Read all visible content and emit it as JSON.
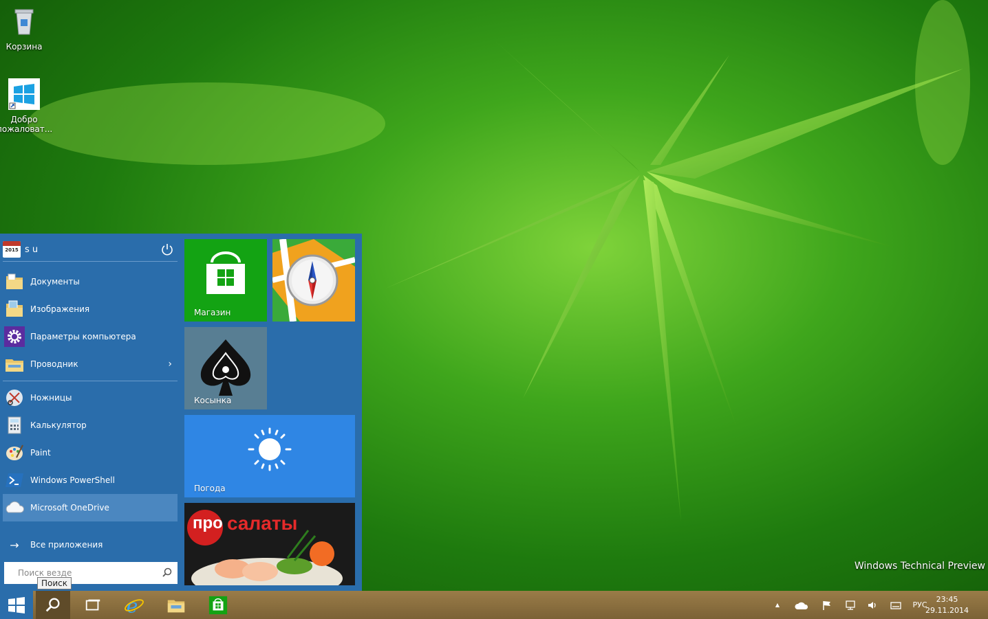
{
  "desktop": {
    "icons": [
      {
        "label": "Корзина"
      },
      {
        "label": "Добро пожаловат..."
      }
    ],
    "watermark": "Windows Technical Preview"
  },
  "start_menu": {
    "user": {
      "name": "s u",
      "calendar_year": "2015"
    },
    "items": [
      {
        "label": "Документы",
        "icon": "documents-folder-icon"
      },
      {
        "label": "Изображения",
        "icon": "pictures-folder-icon"
      },
      {
        "label": "Параметры компьютера",
        "icon": "gear-icon"
      },
      {
        "label": "Проводник",
        "icon": "explorer-folder-icon",
        "chevron": "›"
      }
    ],
    "recent": [
      {
        "label": "Ножницы",
        "icon": "scissors-icon"
      },
      {
        "label": "Калькулятор",
        "icon": "calculator-icon"
      },
      {
        "label": "Paint",
        "icon": "paint-palette-icon"
      },
      {
        "label": "Windows PowerShell",
        "icon": "powershell-icon"
      },
      {
        "label": "Microsoft OneDrive",
        "icon": "cloud-icon",
        "selected": true
      }
    ],
    "all_apps": {
      "label": "Все приложения",
      "arrow": "→"
    },
    "search": {
      "placeholder": "Поиск везде",
      "tooltip": "Поиск"
    },
    "tiles": [
      {
        "label": "Магазин",
        "color": "#13a313"
      },
      {
        "label": "",
        "color": "#1f8f2c"
      },
      {
        "label": "Косынка",
        "color": "#4c7184"
      },
      {
        "label": "Погода",
        "color": "#2f86e4"
      },
      {
        "label": "",
        "logo_text_1": "про",
        "logo_text_2": "салаты",
        "color": "#1a1a1a"
      }
    ]
  },
  "taskbar": {
    "clock_time": "23:45",
    "clock_date": "29.11.2014",
    "language": "РУС",
    "tray_arrow": "▲"
  }
}
